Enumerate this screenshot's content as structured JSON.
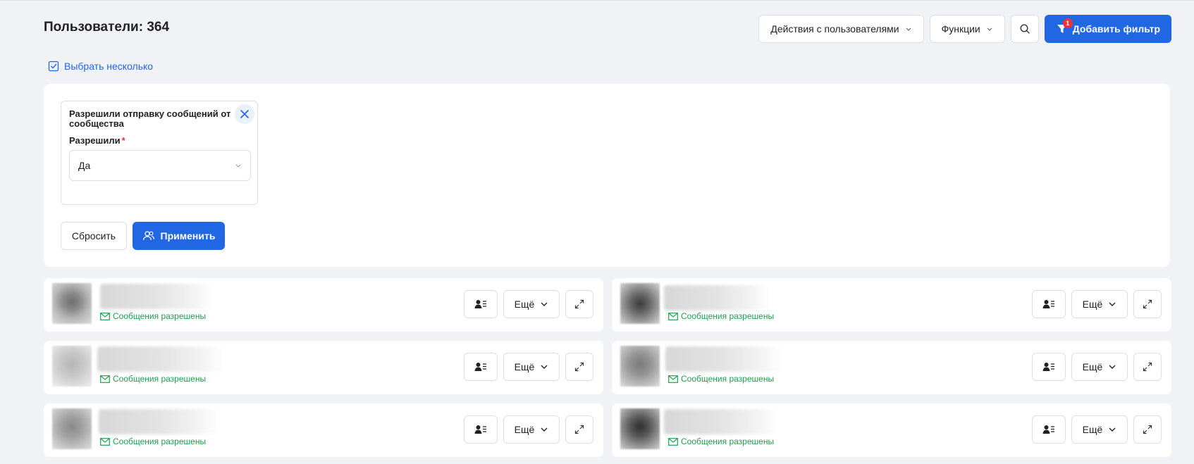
{
  "header": {
    "title": "Пользователи: 364",
    "user_actions_label": "Действия с пользователями",
    "functions_label": "Функции",
    "add_filter_label": "Добавить фильтр",
    "filter_badge": "1"
  },
  "select_multiple_label": "Выбрать несколько",
  "filter": {
    "title": "Разрешили отправку сообщений от сообщества",
    "field_label": "Разрешили",
    "required_mark": "*",
    "value": "Да",
    "reset_label": "Сбросить",
    "apply_label": "Применить"
  },
  "users": [
    {
      "status": "Сообщения разрешены",
      "more_label": "Ещё"
    },
    {
      "status": "Сообщения разрешены",
      "more_label": "Ещё"
    },
    {
      "status": "Сообщения разрешены",
      "more_label": "Ещё"
    },
    {
      "status": "Сообщения разрешены",
      "more_label": "Ещё"
    },
    {
      "status": "Сообщения разрешены",
      "more_label": "Ещё"
    },
    {
      "status": "Сообщения разрешены",
      "more_label": "Ещё"
    }
  ],
  "colors": {
    "accent": "#2167e3",
    "success": "#1e9e4f",
    "badge": "#e5343b",
    "background": "#f1f2f6"
  },
  "icons": {
    "chevron": "chevron-down-icon",
    "search": "search-icon",
    "filter": "filter-icon",
    "checkbox": "checkbox-checked-icon",
    "close": "close-icon",
    "users": "users-icon",
    "profile": "profile-card-icon",
    "expand": "expand-icon",
    "mail": "mail-icon"
  }
}
